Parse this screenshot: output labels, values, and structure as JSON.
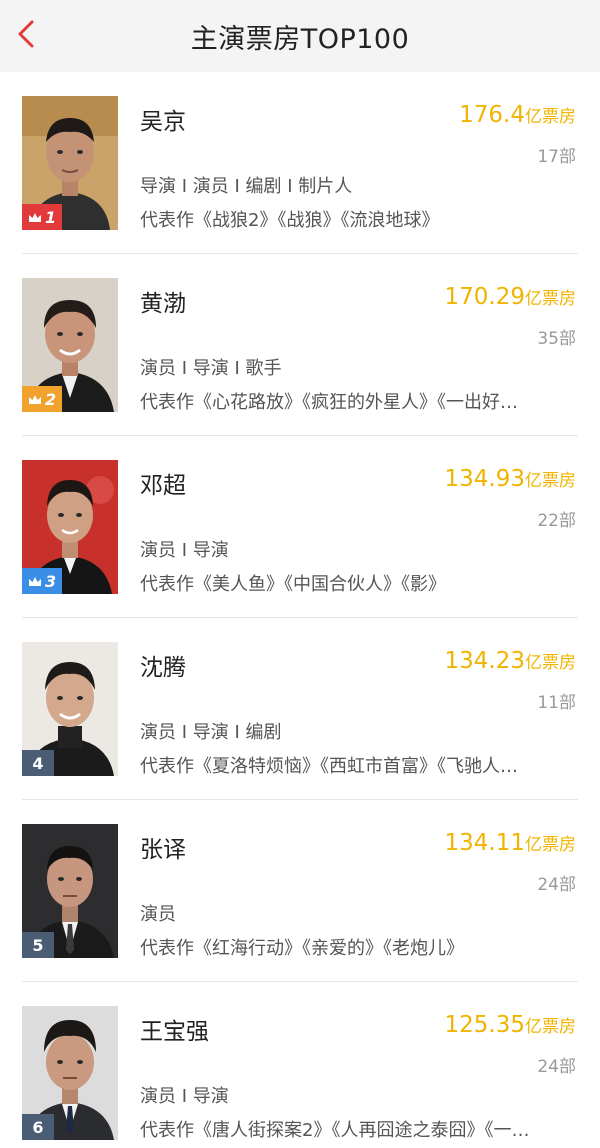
{
  "header": {
    "title": "主演票房TOP100"
  },
  "colors": {
    "gold": "#f0b400",
    "badge_red": "#e23a3a",
    "badge_orange": "#f0a22c",
    "badge_blue": "#3a8ee6",
    "badge_plain": "#4a5d75"
  },
  "actors": [
    {
      "rank": "1",
      "name": "吴京",
      "box_office": "176.4",
      "unit": "亿票房",
      "films": "17部",
      "roles": "导演 I 演员 I 编剧 I 制片人",
      "works": "代表作《战狼2》《战狼》《流浪地球》"
    },
    {
      "rank": "2",
      "name": "黄渤",
      "box_office": "170.29",
      "unit": "亿票房",
      "films": "35部",
      "roles": "演员 I 导演 I 歌手",
      "works": "代表作《心花路放》《疯狂的外星人》《一出好…"
    },
    {
      "rank": "3",
      "name": "邓超",
      "box_office": "134.93",
      "unit": "亿票房",
      "films": "22部",
      "roles": "演员 I 导演",
      "works": "代表作《美人鱼》《中国合伙人》《影》"
    },
    {
      "rank": "4",
      "name": "沈腾",
      "box_office": "134.23",
      "unit": "亿票房",
      "films": "11部",
      "roles": "演员 I 导演 I 编剧",
      "works": "代表作《夏洛特烦恼》《西虹市首富》《飞驰人…"
    },
    {
      "rank": "5",
      "name": "张译",
      "box_office": "134.11",
      "unit": "亿票房",
      "films": "24部",
      "roles": "演员",
      "works": "代表作《红海行动》《亲爱的》《老炮儿》"
    },
    {
      "rank": "6",
      "name": "王宝强",
      "box_office": "125.35",
      "unit": "亿票房",
      "films": "24部",
      "roles": "演员 I 导演",
      "works": "代表作《唐人街探案2》《人再囧途之泰囧》《一…"
    }
  ]
}
